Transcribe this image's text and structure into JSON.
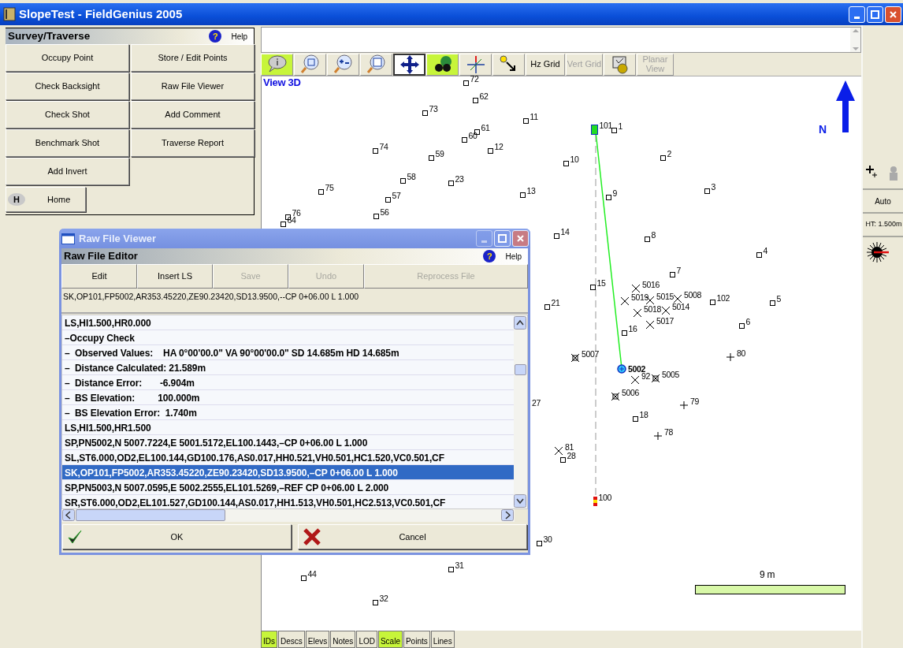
{
  "window": {
    "title": "SlopeTest - FieldGenius 2005"
  },
  "panel": {
    "title": "Survey/Traverse",
    "help_icon": "?",
    "help": "Help",
    "buttons": [
      "Occupy Point",
      "Store / Edit Points",
      "Check Backsight",
      "Raw File Viewer",
      "Check Shot",
      "Add Comment",
      "Benchmark Shot",
      "Traverse Report",
      "Add Invert"
    ],
    "home": {
      "badge": "H",
      "label": "Home"
    }
  },
  "toolbar": [
    {
      "kind": "icon",
      "on": true,
      "pressed": false,
      "disabled": false
    },
    {
      "kind": "icon",
      "on": false,
      "pressed": false,
      "disabled": false
    },
    {
      "kind": "icon",
      "on": false,
      "pressed": false,
      "disabled": false
    },
    {
      "kind": "icon",
      "on": false,
      "pressed": false,
      "disabled": false
    },
    {
      "kind": "icon",
      "on": false,
      "pressed": true,
      "disabled": false
    },
    {
      "kind": "icon",
      "on": true,
      "pressed": false,
      "disabled": false
    },
    {
      "kind": "icon",
      "on": false,
      "pressed": false,
      "disabled": false
    },
    {
      "kind": "icon",
      "on": false,
      "pressed": false,
      "disabled": false
    },
    {
      "kind": "text",
      "label": "Hz Grid",
      "on": false,
      "pressed": false,
      "disabled": false
    },
    {
      "kind": "text",
      "label": "Vert Grid",
      "on": false,
      "pressed": false,
      "disabled": true
    },
    {
      "kind": "icon",
      "on": false,
      "pressed": false,
      "disabled": false
    },
    {
      "kind": "text",
      "label": "Planar View",
      "on": false,
      "pressed": false,
      "disabled": true
    }
  ],
  "map": {
    "view_label": "View 3D",
    "north_label": "N",
    "scale_label": "9 m",
    "points": [
      {
        "label": "72",
        "kind": "square"
      },
      {
        "label": "62",
        "kind": "square"
      },
      {
        "label": "73",
        "kind": "square"
      },
      {
        "label": "11",
        "kind": "square"
      },
      {
        "label": "61",
        "kind": "square"
      },
      {
        "label": "101",
        "kind": "station"
      },
      {
        "label": "1",
        "kind": "square"
      },
      {
        "label": "60",
        "kind": "square"
      },
      {
        "label": "74",
        "kind": "square"
      },
      {
        "label": "12",
        "kind": "square"
      },
      {
        "label": "59",
        "kind": "square"
      },
      {
        "label": "2",
        "kind": "square"
      },
      {
        "label": "10",
        "kind": "square"
      },
      {
        "label": "58",
        "kind": "square"
      },
      {
        "label": "23",
        "kind": "square"
      },
      {
        "label": "75",
        "kind": "square"
      },
      {
        "label": "57",
        "kind": "square"
      },
      {
        "label": "13",
        "kind": "square"
      },
      {
        "label": "9",
        "kind": "square"
      },
      {
        "label": "3",
        "kind": "square"
      },
      {
        "label": "76",
        "kind": "square"
      },
      {
        "label": "56",
        "kind": "square"
      },
      {
        "label": "64",
        "kind": "square"
      },
      {
        "label": "14",
        "kind": "square"
      },
      {
        "label": "8",
        "kind": "square"
      },
      {
        "label": "4",
        "kind": "square"
      },
      {
        "label": "7",
        "kind": "square"
      },
      {
        "label": "15",
        "kind": "square"
      },
      {
        "label": "5016",
        "kind": "cross"
      },
      {
        "label": "21",
        "kind": "square"
      },
      {
        "label": "5019",
        "kind": "cross"
      },
      {
        "label": "5015",
        "kind": "cross"
      },
      {
        "label": "5008",
        "kind": "cross"
      },
      {
        "label": "102",
        "kind": "square"
      },
      {
        "label": "5",
        "kind": "square"
      },
      {
        "label": "5018",
        "kind": "cross"
      },
      {
        "label": "5014",
        "kind": "cross"
      },
      {
        "label": "5017",
        "kind": "cross"
      },
      {
        "label": "6",
        "kind": "square"
      },
      {
        "label": "16",
        "kind": "square"
      },
      {
        "label": "5007",
        "kind": "boxcross"
      },
      {
        "label": "80",
        "kind": "plus"
      },
      {
        "label": "5002",
        "kind": "target"
      },
      {
        "label": "92",
        "kind": "cross"
      },
      {
        "label": "5005",
        "kind": "boxcross"
      },
      {
        "label": "5006",
        "kind": "boxcross"
      },
      {
        "label": "27",
        "kind": "label"
      },
      {
        "label": "79",
        "kind": "plus"
      },
      {
        "label": "18",
        "kind": "square"
      },
      {
        "label": "78",
        "kind": "plus"
      },
      {
        "label": "81",
        "kind": "cross"
      },
      {
        "label": "28",
        "kind": "square"
      },
      {
        "label": "100",
        "kind": "control"
      },
      {
        "label": "30",
        "kind": "square"
      },
      {
        "label": "31",
        "kind": "square"
      },
      {
        "label": "44",
        "kind": "square"
      },
      {
        "label": "32",
        "kind": "square"
      }
    ]
  },
  "bottom_tabs": [
    {
      "label": "IDs",
      "on": true
    },
    {
      "label": "Descs",
      "on": false
    },
    {
      "label": "Elevs",
      "on": false
    },
    {
      "label": "Notes",
      "on": false
    },
    {
      "label": "LOD",
      "on": false
    },
    {
      "label": "Scale",
      "on": true
    },
    {
      "label": "Points",
      "on": false
    },
    {
      "label": "Lines",
      "on": false
    }
  ],
  "side": {
    "auto": "Auto",
    "height": "HT: 1.500m"
  },
  "dialog": {
    "title": "Raw File Viewer",
    "header": "Raw File Editor",
    "help_icon": "?",
    "help": "Help",
    "buttons": [
      {
        "label": "Edit",
        "disabled": false
      },
      {
        "label": "Insert LS",
        "disabled": false
      },
      {
        "label": "Save",
        "disabled": true
      },
      {
        "label": "Undo",
        "disabled": true
      },
      {
        "label": "Reprocess File",
        "disabled": true
      }
    ],
    "current_line": "SK,OP101,FP5002,AR353.45220,ZE90.23420,SD13.9500,--CP 0+06.00 L 1.000",
    "lines": [
      {
        "text": "LS,HI1.500,HR0.000",
        "selected": false
      },
      {
        "text": "–Occupy Check",
        "selected": false
      },
      {
        "text": "–  Observed Values:    HA 0°00'00.0\" VA 90°00'00.0\" SD 14.685m HD 14.685m",
        "selected": false
      },
      {
        "text": "–  Distance Calculated: 21.589m",
        "selected": false
      },
      {
        "text": "–  Distance Error:       -6.904m",
        "selected": false
      },
      {
        "text": "–  BS Elevation:         100.000m",
        "selected": false
      },
      {
        "text": "–  BS Elevation Error:  1.740m",
        "selected": false
      },
      {
        "text": "LS,HI1.500,HR1.500",
        "selected": false
      },
      {
        "text": "SP,PN5002,N 5007.7224,E 5001.5172,EL100.1443,–CP 0+06.00 L 1.000",
        "selected": false
      },
      {
        "text": "SL,ST6.000,OD2,EL100.144,GD100.176,AS0.017,HH0.521,VH0.501,HC1.520,VC0.501,CF",
        "selected": false
      },
      {
        "text": "SK,OP101,FP5002,AR353.45220,ZE90.23420,SD13.9500,–CP 0+06.00 L 1.000",
        "selected": true
      },
      {
        "text": "SP,PN5003,N 5007.0595,E 5002.2555,EL101.5269,–REF CP 0+06.00 L 2.000",
        "selected": false
      },
      {
        "text": "SR,ST6.000,OD2,EL101.527,GD100.144,AS0.017,HH1.513,VH0.501,HC2.513,VC0.501,CF",
        "selected": false
      }
    ],
    "ok": "OK",
    "cancel": "Cancel"
  }
}
